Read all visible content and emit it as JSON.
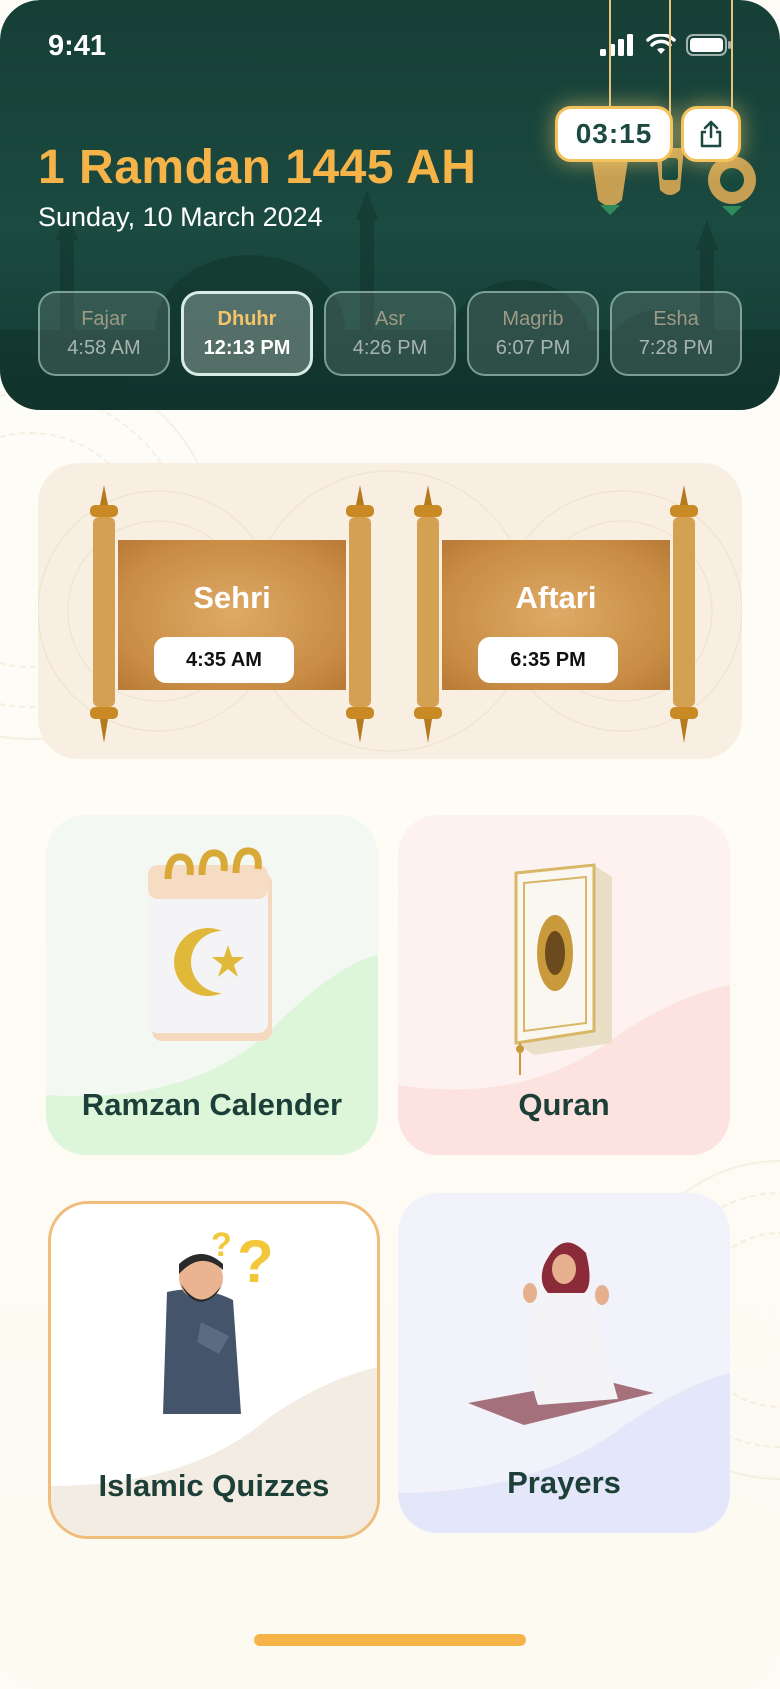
{
  "status_bar": {
    "time": "9:41"
  },
  "header": {
    "hijri_date": "1 Ramdan 1445 AH",
    "gregorian_date": "Sunday, 10 March 2024",
    "countdown": "03:15"
  },
  "prayers": [
    {
      "name": "Fajar",
      "time": "4:58 AM",
      "active": false
    },
    {
      "name": "Dhuhr",
      "time": "12:13 PM",
      "active": true
    },
    {
      "name": "Asr",
      "time": "4:26 PM",
      "active": false
    },
    {
      "name": "Magrib",
      "time": "6:07 PM",
      "active": false
    },
    {
      "name": "Esha",
      "time": "7:28 PM",
      "active": false
    }
  ],
  "sehri": {
    "label": "Sehri",
    "time": "4:35 AM"
  },
  "aftari": {
    "label": "Aftari",
    "time": "6:35 PM"
  },
  "tiles": {
    "calendar": "Ramzan Calender",
    "quran": "Quran",
    "quizzes": "Islamic Quizzes",
    "prayers": "Prayers"
  },
  "colors": {
    "header_green": "#163f36",
    "accent_gold": "#f6b448",
    "tile_label": "#1c3f38"
  }
}
